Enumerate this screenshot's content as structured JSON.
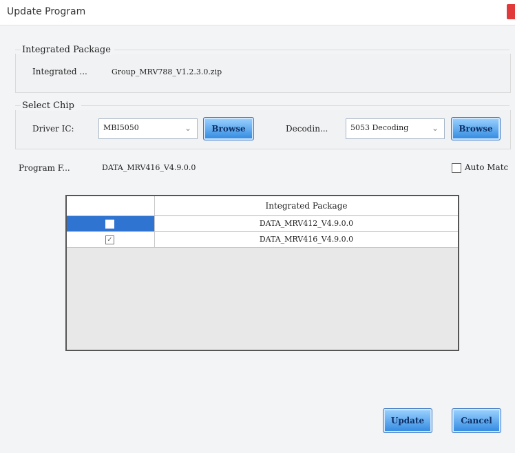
{
  "window": {
    "title": "Update Program"
  },
  "integrated_package": {
    "group_title": "Integrated Package",
    "label": "Integrated ...",
    "value": "Group_MRV788_V1.2.3.0.zip"
  },
  "select_chip": {
    "group_title": "Select Chip",
    "driver_label": "Driver IC:",
    "driver_value": "MBI5050",
    "decoding_label": "Decodin...",
    "decoding_value": "5053 Decoding",
    "browse_label": "Browse"
  },
  "program": {
    "label": "Program F...",
    "value": "DATA_MRV416_V4.9.0.0",
    "auto_match_label": "Auto Matc"
  },
  "table": {
    "header": "Integrated Package",
    "rows": [
      {
        "name": "DATA_MRV412_V4.9.0.0",
        "checked": false,
        "selected": true
      },
      {
        "name": "DATA_MRV416_V4.9.0.0",
        "checked": true,
        "selected": false
      }
    ]
  },
  "footer": {
    "update_label": "Update",
    "cancel_label": "Cancel"
  },
  "colors": {
    "accent": "#2f74d0",
    "close": "#e03a3a"
  }
}
